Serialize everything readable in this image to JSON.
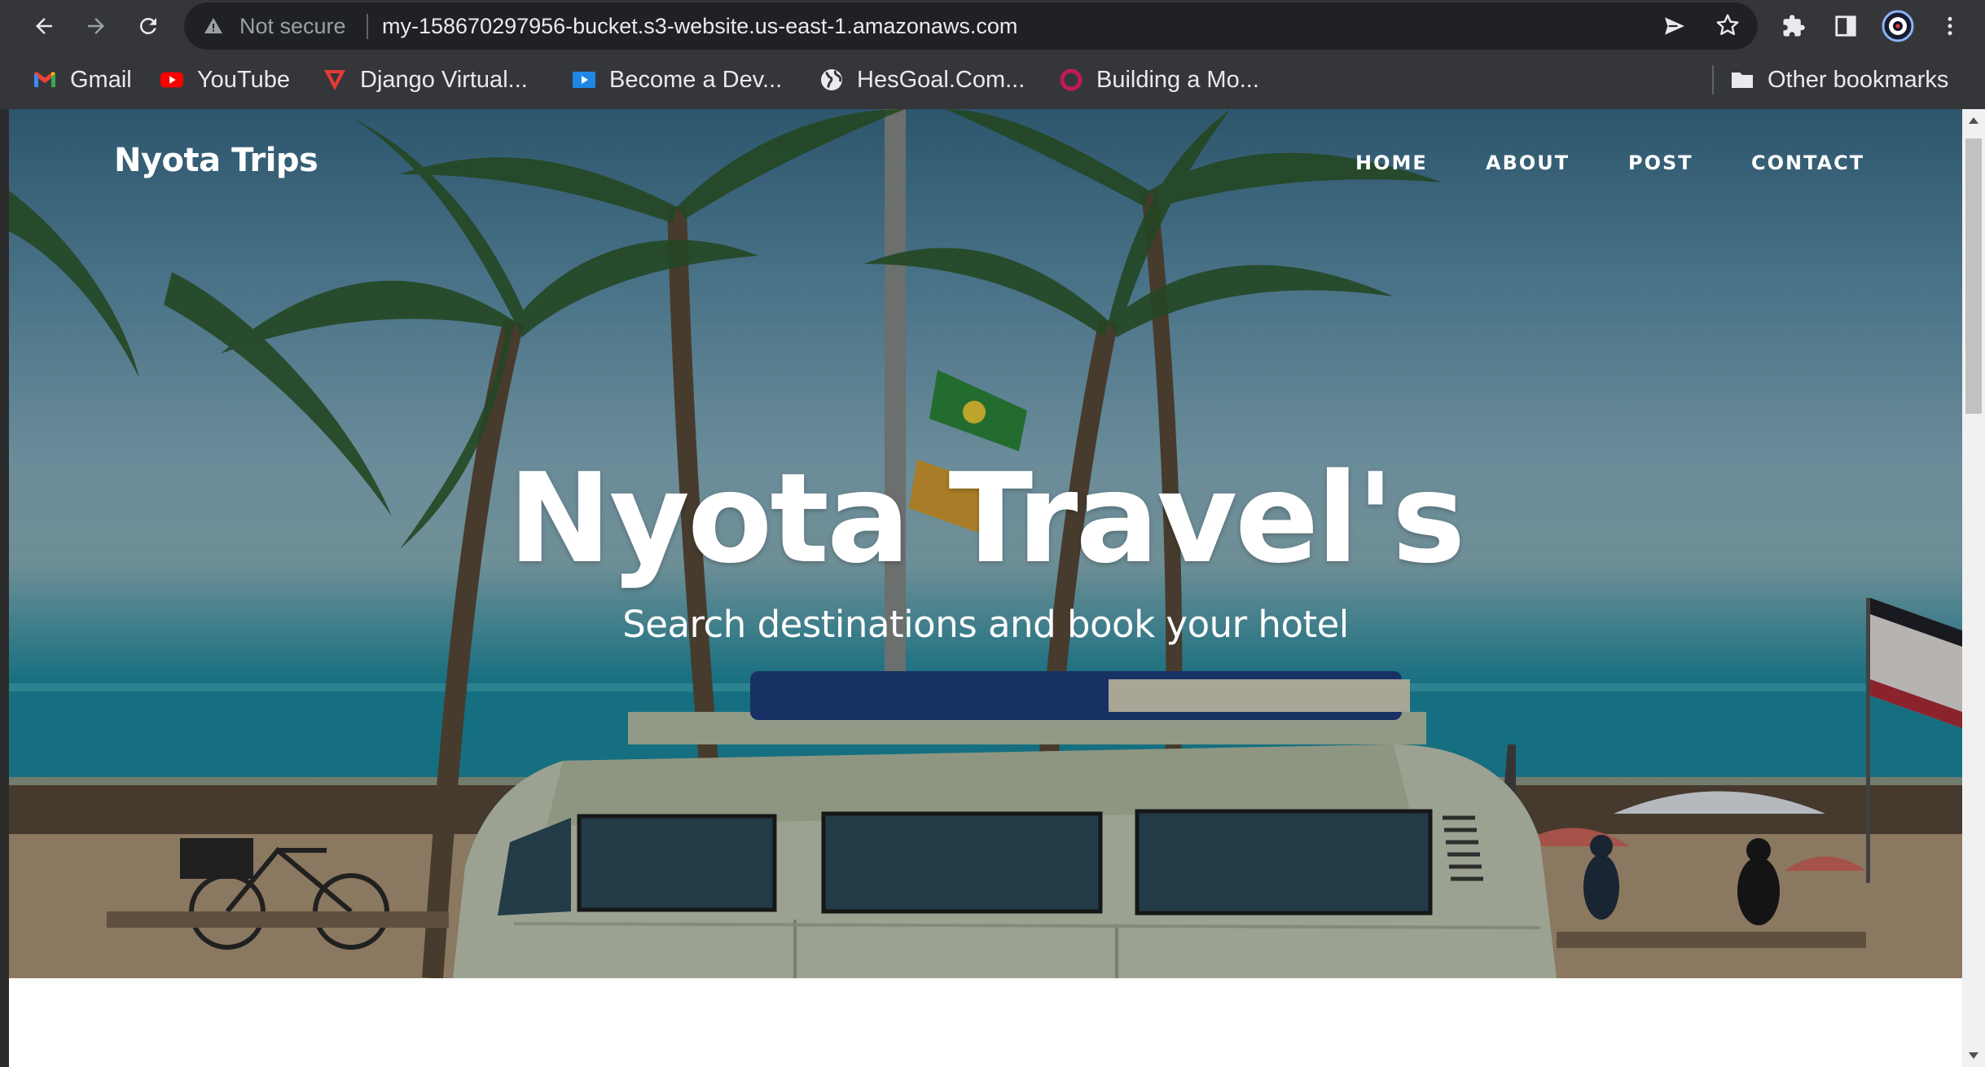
{
  "browser": {
    "security_label": "Not secure",
    "url": "my-158670297956-bucket.s3-website.us-east-1.amazonaws.com",
    "icons": [
      "back-icon",
      "forward-icon",
      "reload-icon",
      "warning-icon",
      "send-icon",
      "star-icon",
      "extensions-icon",
      "side-panel-icon",
      "profile-icon",
      "menu-icon"
    ]
  },
  "bookmarks": {
    "items": [
      {
        "label": "Gmail",
        "icon": "gmail-icon"
      },
      {
        "label": "YouTube",
        "icon": "youtube-icon"
      },
      {
        "label": "Django Virtual...",
        "icon": "django-icon"
      },
      {
        "label": "Become a Dev...",
        "icon": "video-icon"
      },
      {
        "label": "HesGoal.Com...",
        "icon": "globe-icon"
      },
      {
        "label": "Building a Mo...",
        "icon": "ring-icon"
      }
    ],
    "other": "Other bookmarks"
  },
  "site": {
    "brand": "Nyota Trips",
    "nav": [
      "HOME",
      "ABOUT",
      "POST",
      "CONTACT"
    ],
    "hero_title": "Nyota Travel's",
    "hero_subtitle": "Search destinations and book your hotel"
  },
  "colors": {
    "chrome_bg": "#35363a",
    "omnibox_bg": "#202124",
    "hero_text": "#ffffff"
  }
}
